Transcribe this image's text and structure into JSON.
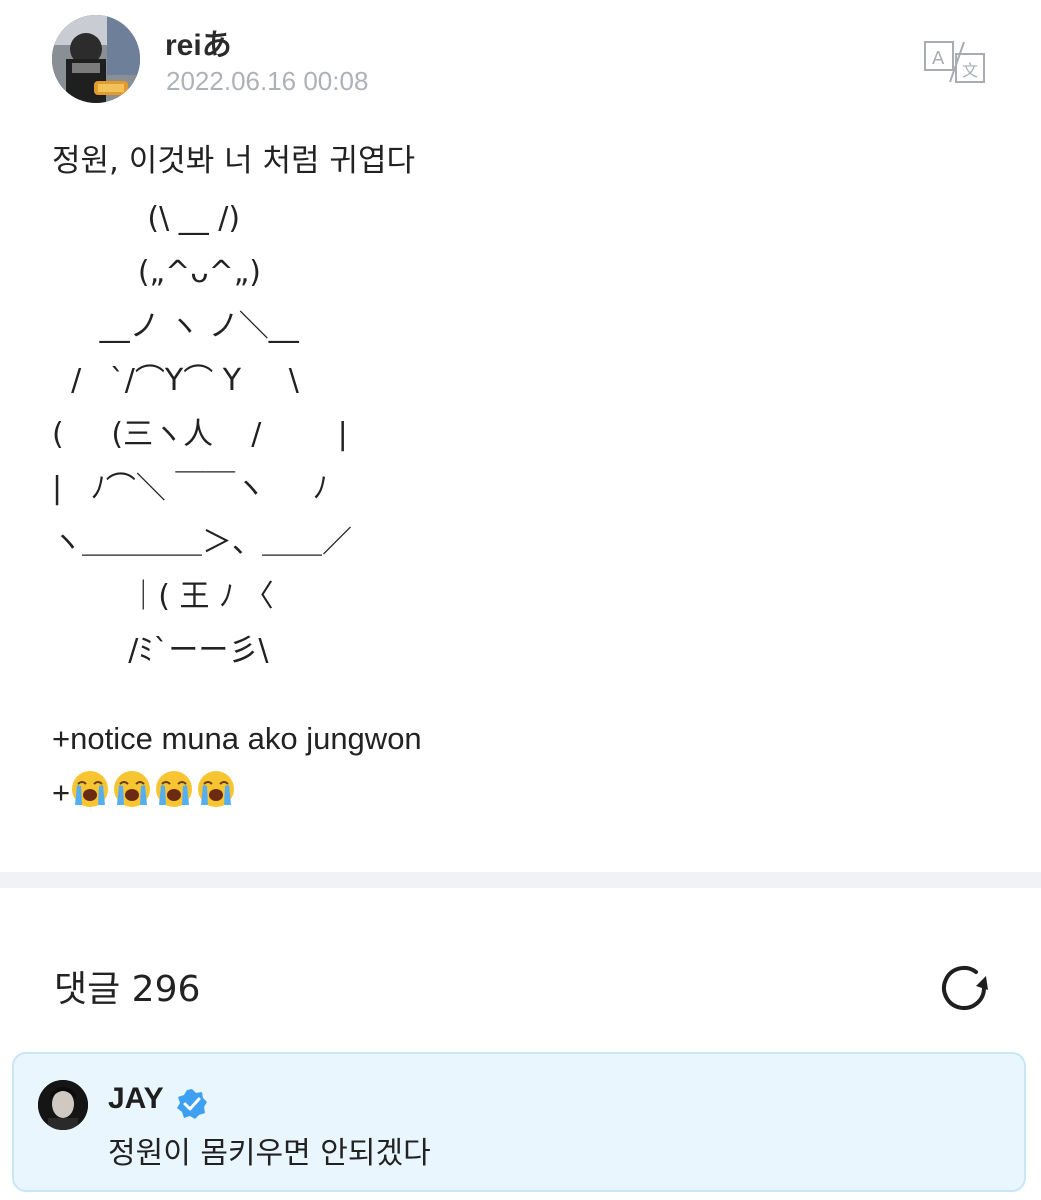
{
  "post": {
    "author": "reiあ",
    "timestamp": "2022.06.16 00:08",
    "text": "정원, 이것봐 너 처럼 귀엽다",
    "ascii_art": "          (\\ __ /)\n         („^ᴗ^„)\n     __ノ ヽ ノ＼__\n  /   `/⌒Y⌒ Y     \\\n(     (三ヽ人    /        |\n|   ﾉ⌒＼ ￣￣ヽ     ﾉ\nヽ＿＿＿＿＞、＿＿／\n        ｜( 王 ﾉ 〈\n        /ﾐ`ーー彡\\",
    "notice_line": "+notice muna ako jungwon",
    "emoji_prefix": "+",
    "emoji_count": 4,
    "emoji_name": "loudly-crying-face"
  },
  "icons": {
    "translate": "translate-icon",
    "refresh": "refresh-icon",
    "verified": "verified-badge-icon"
  },
  "comments": {
    "title": "댓글 296",
    "items": [
      {
        "author": "JAY",
        "verified": true,
        "text": "정원이 몸키우면 안되겠다"
      }
    ]
  },
  "colors": {
    "timestamp": "#aeb2b8",
    "divider": "#f1f2f5",
    "comment_bg": "#e9f6fd",
    "comment_border": "#c8e6f5",
    "verified_blue": "#3ea0f0"
  }
}
